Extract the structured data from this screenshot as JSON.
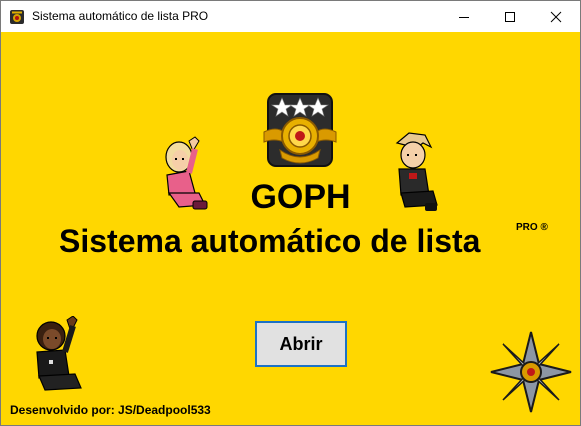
{
  "window": {
    "title": "Sistema automático de lista PRO",
    "icons": {
      "app": "app-badge-icon",
      "minimize": "minimize-icon",
      "maximize": "maximize-icon",
      "close": "close-icon"
    }
  },
  "main": {
    "heading": "GOPH",
    "subheading": "Sistema automático de lista",
    "pro_mark": "PRO ®",
    "open_button_label": "Abrir",
    "credit": "Desenvolvido por: JS/Deadpool533"
  },
  "colors": {
    "background": "#ffd700",
    "button_face": "#e1e1e1",
    "button_border": "#1c72c6",
    "titlebar": "#ffffff"
  }
}
